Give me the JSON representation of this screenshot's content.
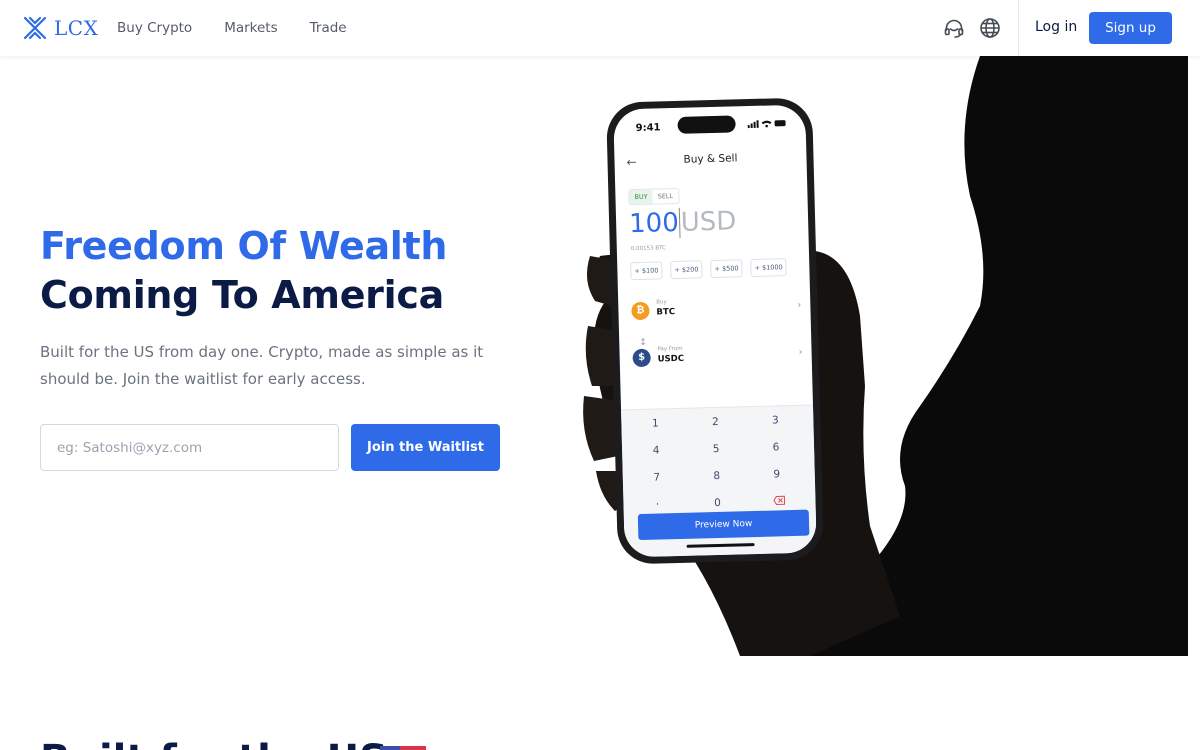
{
  "header": {
    "logo_text": "LCX",
    "nav": [
      "Buy Crypto",
      "Markets",
      "Trade"
    ],
    "support_icon": "headset-icon",
    "language_icon": "globe-icon",
    "login_label": "Log in",
    "signup_label": "Sign up"
  },
  "hero": {
    "title_line1": "Freedom Of Wealth",
    "title_line2": "Coming To America",
    "subtitle": "Built for the US from day one. Crypto, made as simple as it should be. Join the waitlist for early access.",
    "email_placeholder": "eg: Satoshi@xyz.com",
    "waitlist_button": "Join the Waitlist"
  },
  "phone": {
    "time": "9:41",
    "screen_title": "Buy & Sell",
    "tabs": [
      "BUY",
      "SELL"
    ],
    "active_tab": "BUY",
    "amount": "100",
    "amount_currency": "USD",
    "btc_equivalent": "0.00153 BTC",
    "presets": [
      "+ $100",
      "+ $200",
      "+ $500",
      "+ $1000"
    ],
    "buy_label": "Buy",
    "buy_asset": "BTC",
    "pay_label": "Pay From",
    "pay_asset": "USDC",
    "keypad": [
      "1",
      "2",
      "3",
      "4",
      "5",
      "6",
      "7",
      "8",
      "9",
      ".",
      "0"
    ],
    "preview_button": "Preview Now"
  },
  "next_section": {
    "title": "Built for the US"
  },
  "colors": {
    "accent": "#2f6ae8",
    "heading_dark": "#0b1b46",
    "text_muted": "#6b7280"
  }
}
